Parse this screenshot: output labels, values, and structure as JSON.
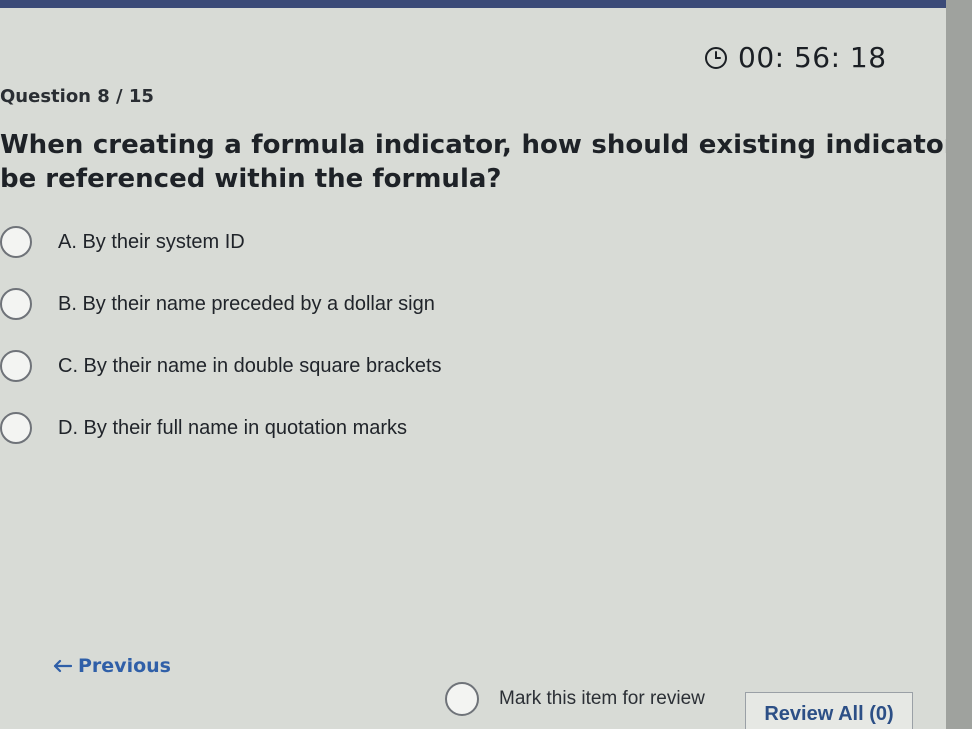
{
  "timer": {
    "icon": "clock-icon",
    "value": "00: 56: 18"
  },
  "question": {
    "counter": "Question 8 / 15",
    "text": "When creating a formula indicator, how should existing indicators be referenced within the formula?"
  },
  "options": [
    {
      "label": "A. By their system ID"
    },
    {
      "label": "B. By their name preceded by a dollar sign"
    },
    {
      "label": "C. By their name in double square brackets"
    },
    {
      "label": "D. By their full name in quotation marks"
    }
  ],
  "nav": {
    "previous_label": "Previous",
    "previous_icon": "arrow-left-icon"
  },
  "footer": {
    "mark_review_label": "Mark this item for review",
    "review_all_label": "Review All (0)"
  },
  "colors": {
    "link": "#2f5fa8",
    "text": "#1f2329",
    "background": "#d8dbd6"
  }
}
